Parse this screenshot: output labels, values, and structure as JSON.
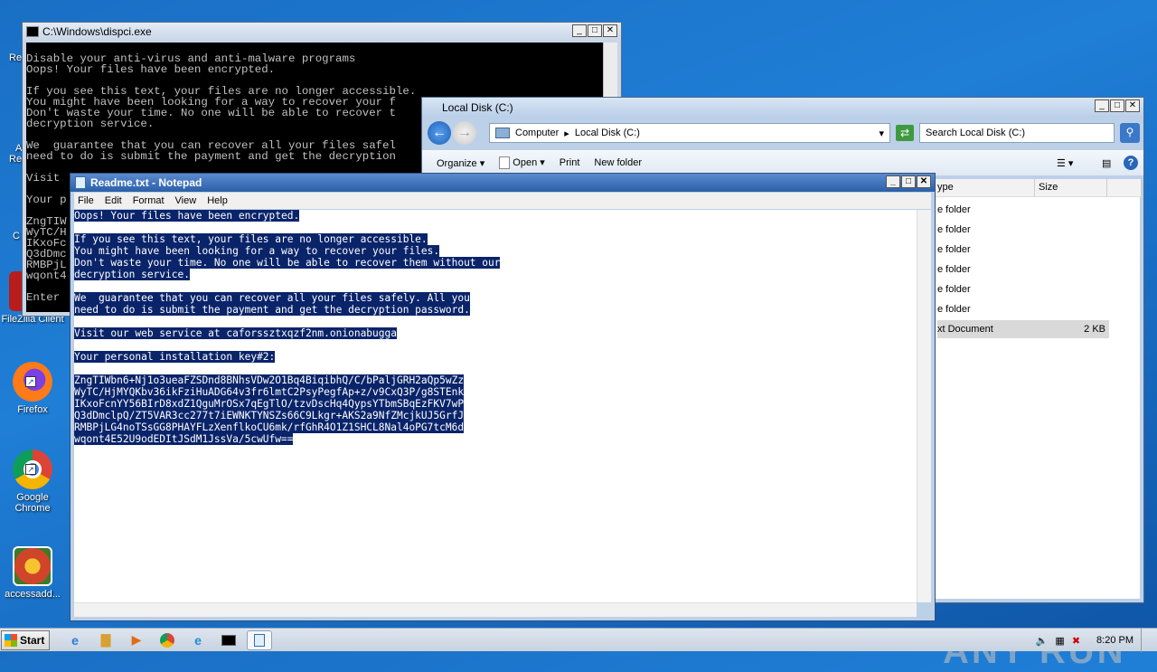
{
  "desktop": {
    "icons": [
      {
        "label": "FileZilla Client",
        "color": "#b81d1d"
      },
      {
        "label": "Firefox",
        "color": "#ff7a18"
      },
      {
        "label": "Google Chrome",
        "color": "#2b9b3f"
      },
      {
        "label": "accessadd...",
        "color": "#d0452a"
      }
    ],
    "partial_labels": [
      "Re",
      "A",
      "Re",
      "C"
    ]
  },
  "cmd": {
    "title": "C:\\Windows\\dispci.exe",
    "lines": [
      "Disable your anti-virus and anti-malware programs",
      "Oops! Your files have been encrypted.",
      "",
      "If you see this text, your files are no longer accessible.",
      "You might have been looking for a way to recover your f",
      "Don't waste your time. No one will be able to recover t",
      "decryption service.",
      "",
      "We  guarantee that you can recover all your files safel",
      "need to do is submit the payment and get the decryption",
      "",
      "Visit",
      "",
      "Your p",
      "",
      "ZngTIW",
      "WyTC/H",
      "IKxoFc",
      "Q3dDmc",
      "RMBPjL",
      "wqont4",
      "",
      "Enter"
    ]
  },
  "explorer": {
    "title": "Local Disk (C:)",
    "breadcrumb": [
      "Computer",
      "Local Disk (C:)"
    ],
    "search_placeholder": "Search Local Disk (C:)",
    "toolbar": [
      "Organize",
      "Open",
      "Print",
      "New folder"
    ],
    "columns": [
      "ype",
      "Size"
    ],
    "rows": [
      {
        "type": "e folder",
        "size": ""
      },
      {
        "type": "e folder",
        "size": ""
      },
      {
        "type": "e folder",
        "size": ""
      },
      {
        "type": "e folder",
        "size": ""
      },
      {
        "type": "e folder",
        "size": ""
      },
      {
        "type": "e folder",
        "size": ""
      },
      {
        "type": "xt Document",
        "size": "2 KB"
      }
    ]
  },
  "notepad": {
    "title": "Readme.txt - Notepad",
    "menu": [
      "File",
      "Edit",
      "Format",
      "View",
      "Help"
    ],
    "lines": [
      "Oops! Your files have been encrypted.",
      "",
      "If you see this text, your files are no longer accessible.",
      "You might have been looking for a way to recover your files.",
      "Don't waste your time. No one will be able to recover them without our",
      "decryption service.",
      "",
      "We  guarantee that you can recover all your files safely. All you",
      "need to do is submit the payment and get the decryption password.",
      "",
      "Visit our web service at caforssztxqzf2nm.onionabugga",
      "",
      "Your personal installation key#2:",
      "",
      "ZngTIWbn6+Nj1o3ueaFZSDnd8BNhsVDw2O1Bq4BiqibhQ/C/bPaljGRH2aQp5wZz",
      "WyTC/HjMYQKbv36ikFziHuADG64v3fr6lmtC2PsyPegfAp+z/v9CxQ3P/g8STEnk",
      "IKxoFcnYY56BIrD8xdZ1QguMrOSx7qEgTlO/tzvDscHq4QypsYTbmSBqEzFKV7wP",
      "Q3dDmclpQ/ZT5VAR3cc277t7iEWNKTYNSZs66C9Lkgr+AKS2a9NfZMcjkUJ5GrfJ",
      "RMBPjLG4noTSsGG8PHAYFLzXenflkoCU6mk/rfGhR4O1Z1SHCL8Nal4oPG7tcM6d",
      "wqont4E52U9odEDItJSdM1JssVa/5cwUfw=="
    ]
  },
  "taskbar": {
    "start_label": "Start",
    "clock": "8:20 PM"
  },
  "watermark": "ANY RUN"
}
